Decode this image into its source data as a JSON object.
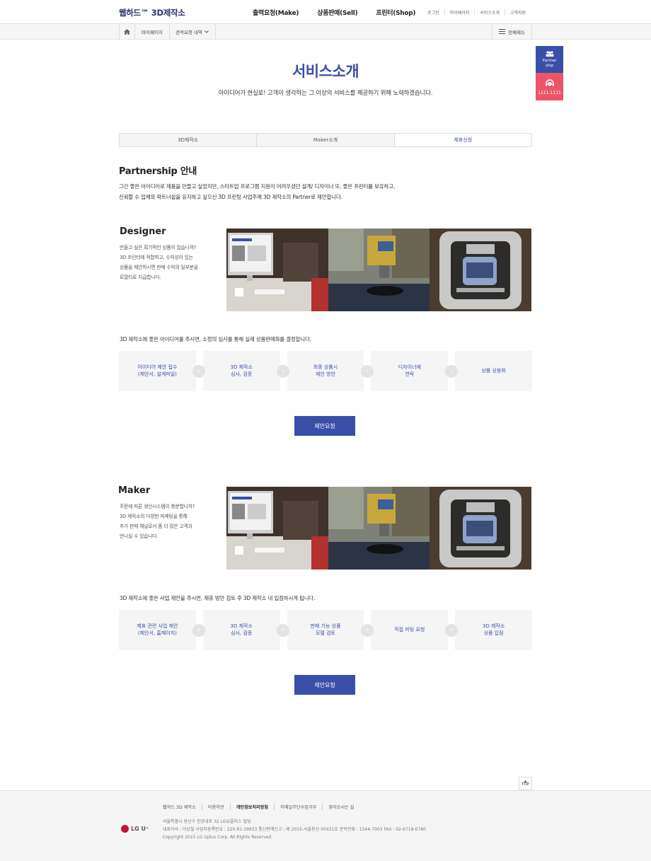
{
  "header": {
    "logo": "웹하드™ 3D제작소",
    "gnb": [
      "출력요청(Make)",
      "상품판매(Sell)",
      "프린터(Shop)"
    ],
    "util": [
      "로그인",
      "마이페이지",
      "서비스소개",
      "고객지원"
    ]
  },
  "location": {
    "items": [
      "마이페이지",
      "견적요청 내역"
    ],
    "allmenu": "전체메뉴"
  },
  "quick": {
    "partner": "Partner ship",
    "call": "1111-1111"
  },
  "page": {
    "title": "서비스소개",
    "desc": "아이디어가 현실로! 고객이 생각하는 그 이상의 서비스를 제공하기 위해 노력하겠습니다."
  },
  "tabs": [
    "3D제작소",
    "Maker소개",
    "제휴신청"
  ],
  "partnership": {
    "title": "Partnership 안내",
    "intro_1": "그간 좋은 아이디어로 제품을 만들고 싶었지만, 스타트업 프로그램 지원이 어려우셨던 설계/ 디자이너 또, 좋은 프린터를 보유하고,",
    "intro_2": "신뢰할 수 업체와 파트너쉽을 유지하고 싶으신 3D 프린팅 사업주께 3D 제작소의 Partner로 제안합니다."
  },
  "designer": {
    "title": "Designer",
    "desc": [
      "만들고 싶은 획기적인 상품이 있습니까?",
      "3D 프린터에 적합하고, 수익성이 있는",
      "상품을 제안하시면 판매 수익의 일부분을",
      "로열티로 지급합니다."
    ],
    "lead": "3D 제작소에 좋은 아이디어를 주시면, 소정의 심사를 통해 실제 상품판매화를 결정합니다.",
    "steps": [
      {
        "l1": "아이디어 제안 접수",
        "l2": "(제안서, 설계파일)"
      },
      {
        "l1": "3D 제작소",
        "l2": "심사, 검증"
      },
      {
        "l1": "최종 상품시",
        "l2": "제안 방안"
      },
      {
        "l1": "디자이너에",
        "l2": "연락"
      },
      {
        "l1": "상품 상용화",
        "l2": ""
      }
    ],
    "button": "제안요청"
  },
  "maker": {
    "title": "Maker",
    "desc": [
      "주문에 따른 생산시스템이 충분합니까?",
      "3D 제작소의 다양한 마케팅을 통해",
      "추가 판매 채널로서 좀 더 많은 고객과",
      "만나실 수 있습니다."
    ],
    "lead": "3D 제작소에 좋은 사업 제안을 주시면, 제휴 방안 검토 후 3D 제작소 내 입점하시게 됩니다.",
    "steps": [
      {
        "l1": "제휴 관련 사업 제안",
        "l2": "(제안서, 홈페이지)"
      },
      {
        "l1": "3D 제작소",
        "l2": "심사, 검증"
      },
      {
        "l1": "판매 가능 상품",
        "l2": "모델 검토"
      },
      {
        "l1": "직접 미팅 요청",
        "l2": ""
      },
      {
        "l1": "3D 제작소",
        "l2": "상품 입점"
      }
    ],
    "button": "제안요청"
  },
  "footer": {
    "top": "TOP",
    "links": [
      "웹하드 3D 제작소",
      "이용약관",
      "개인정보처리방침",
      "이메일무단수집거부",
      "찾아오시는 길"
    ],
    "logo": "LG U⁺",
    "address": "서울특별시 용산구 한강대로 32 LG유플러스 빌딩",
    "biz": "대표이사 : 이상철     사업자등록번호 : 220-81-39933     통신판매신고 : 제 2015-서울용산-00431호     문의전화 : 1544-7003     FAX : 02-6718-6780",
    "copyright": "Copyright 2015 LG Uplus Corp. All Rights Reserved."
  },
  "colors": {
    "accent": "#3a4fa8",
    "call": "#ec5568"
  }
}
